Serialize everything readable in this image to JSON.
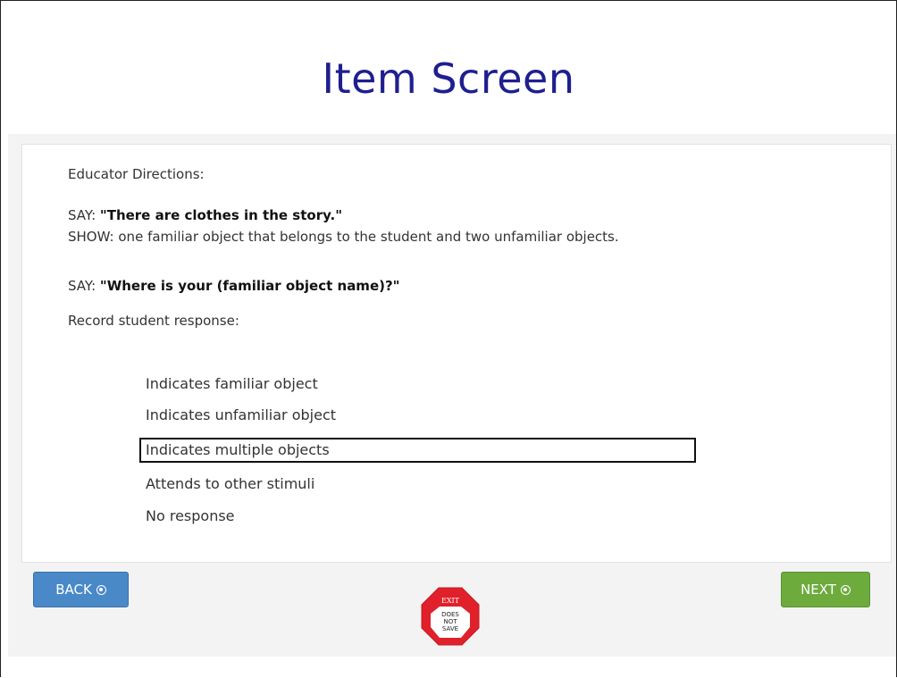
{
  "title": "Item Screen",
  "directions": {
    "heading": "Educator Directions:",
    "say1_prefix": "SAY: ",
    "say1_quote": "\"There are clothes in the story.\"",
    "show": "SHOW: one familiar object that belongs to the student and two unfamiliar objects.",
    "say2_prefix": "SAY: ",
    "say2_quote": "\"Where is your (familiar object name)?\"",
    "record": "Record student response:"
  },
  "options": [
    {
      "label": "Indicates familiar object",
      "selected": false
    },
    {
      "label": "Indicates unfamiliar object",
      "selected": false
    },
    {
      "label": "Indicates multiple objects",
      "selected": true
    },
    {
      "label": "Attends to other stimuli",
      "selected": false
    },
    {
      "label": "No response",
      "selected": false
    }
  ],
  "nav": {
    "back_label": "BACK",
    "next_label": "NEXT",
    "exit_label": "EXIT",
    "exit_line1": "DOES",
    "exit_line2": "NOT",
    "exit_line3": "SAVE"
  },
  "colors": {
    "title": "#1f1f8f",
    "back": "#4a89c8",
    "next": "#6cab3c",
    "exit_red": "#e0202a"
  }
}
